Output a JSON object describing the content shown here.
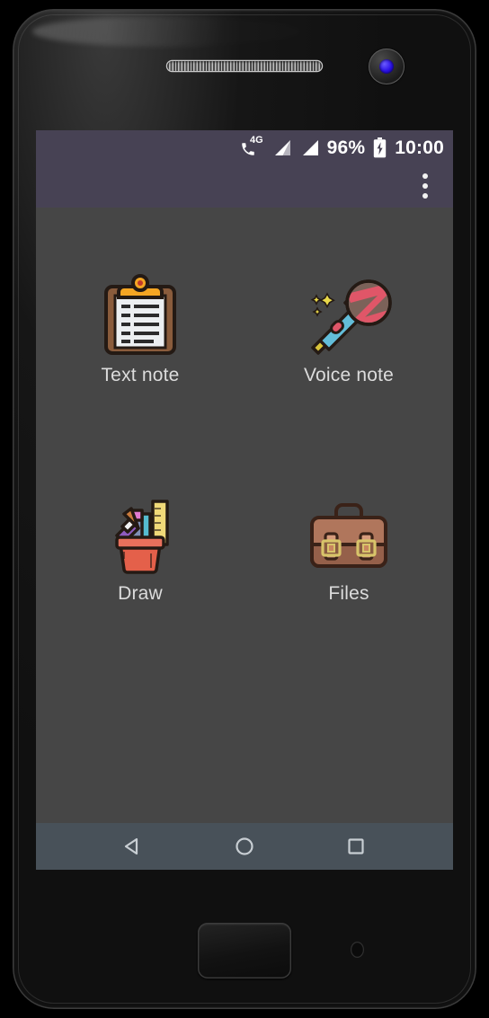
{
  "device": {
    "type": "android-phone",
    "speaker_name": "earpiece-speaker",
    "camera_name": "front-camera",
    "home_button_name": "physical-home-button"
  },
  "status_bar": {
    "background": "#474254",
    "network_label": "4G",
    "battery_percent": "96%",
    "time": "10:00",
    "icons": [
      "phone-4g-icon",
      "signal-bars-icon",
      "signal-bars-icon",
      "battery-charging-icon"
    ]
  },
  "app_bar": {
    "background": "#474254",
    "overflow_menu_label": "More options"
  },
  "content": {
    "background": "#464646",
    "tiles": [
      {
        "id": "text-note",
        "label": "Text note",
        "icon": "clipboard-icon"
      },
      {
        "id": "voice-note",
        "label": "Voice note",
        "icon": "microphone-icon"
      },
      {
        "id": "draw",
        "label": "Draw",
        "icon": "pen-cup-icon"
      },
      {
        "id": "files",
        "label": "Files",
        "icon": "briefcase-icon"
      }
    ],
    "label_color": "#dcdcdc"
  },
  "nav_bar": {
    "background": "#485159",
    "buttons": [
      {
        "id": "back",
        "icon": "back-triangle-icon",
        "label": "Back"
      },
      {
        "id": "home",
        "icon": "home-circle-icon",
        "label": "Home"
      },
      {
        "id": "recents",
        "icon": "recents-square-icon",
        "label": "Recents"
      }
    ]
  }
}
